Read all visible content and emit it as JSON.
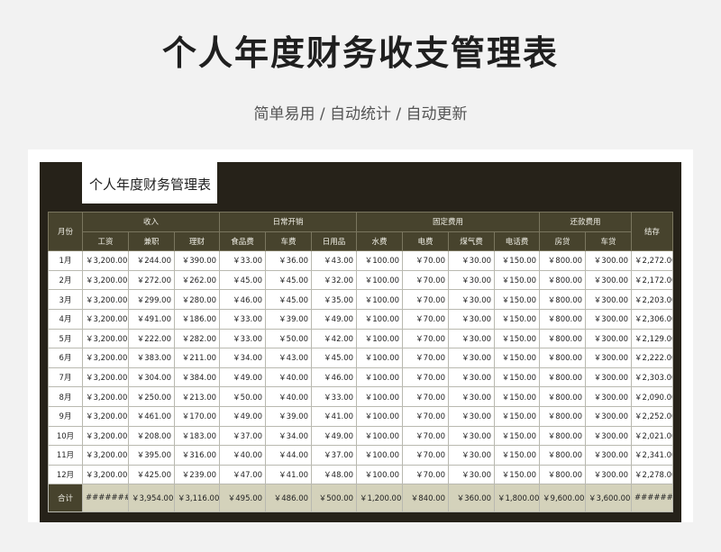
{
  "page": {
    "title": "个人年度财务收支管理表",
    "subtitle": "简单易用 / 自动统计 / 自动更新"
  },
  "sheet": {
    "title": "个人年度财务管理表",
    "headers": {
      "month": "月份",
      "income": "收入",
      "daily": "日常开销",
      "fixed": "固定费用",
      "repay": "还款费用",
      "balance": "结存",
      "sub": [
        "工资",
        "兼职",
        "理财",
        "食品费",
        "车费",
        "日用品",
        "水费",
        "电费",
        "煤气费",
        "电话费",
        "房贷",
        "车贷"
      ]
    },
    "rows": [
      {
        "month": "1月",
        "cells": [
          "￥3,200.00",
          "￥244.00",
          "￥390.00",
          "￥33.00",
          "￥36.00",
          "￥43.00",
          "￥100.00",
          "￥70.00",
          "￥30.00",
          "￥150.00",
          "￥800.00",
          "￥300.00",
          "￥2,272.00"
        ]
      },
      {
        "month": "2月",
        "cells": [
          "￥3,200.00",
          "￥272.00",
          "￥262.00",
          "￥45.00",
          "￥45.00",
          "￥32.00",
          "￥100.00",
          "￥70.00",
          "￥30.00",
          "￥150.00",
          "￥800.00",
          "￥300.00",
          "￥2,172.00"
        ]
      },
      {
        "month": "3月",
        "cells": [
          "￥3,200.00",
          "￥299.00",
          "￥280.00",
          "￥46.00",
          "￥45.00",
          "￥35.00",
          "￥100.00",
          "￥70.00",
          "￥30.00",
          "￥150.00",
          "￥800.00",
          "￥300.00",
          "￥2,203.00"
        ]
      },
      {
        "month": "4月",
        "cells": [
          "￥3,200.00",
          "￥491.00",
          "￥186.00",
          "￥33.00",
          "￥39.00",
          "￥49.00",
          "￥100.00",
          "￥70.00",
          "￥30.00",
          "￥150.00",
          "￥800.00",
          "￥300.00",
          "￥2,306.00"
        ]
      },
      {
        "month": "5月",
        "cells": [
          "￥3,200.00",
          "￥222.00",
          "￥282.00",
          "￥33.00",
          "￥50.00",
          "￥42.00",
          "￥100.00",
          "￥70.00",
          "￥30.00",
          "￥150.00",
          "￥800.00",
          "￥300.00",
          "￥2,129.00"
        ]
      },
      {
        "month": "6月",
        "cells": [
          "￥3,200.00",
          "￥383.00",
          "￥211.00",
          "￥34.00",
          "￥43.00",
          "￥45.00",
          "￥100.00",
          "￥70.00",
          "￥30.00",
          "￥150.00",
          "￥800.00",
          "￥300.00",
          "￥2,222.00"
        ]
      },
      {
        "month": "7月",
        "cells": [
          "￥3,200.00",
          "￥304.00",
          "￥384.00",
          "￥49.00",
          "￥40.00",
          "￥46.00",
          "￥100.00",
          "￥70.00",
          "￥30.00",
          "￥150.00",
          "￥800.00",
          "￥300.00",
          "￥2,303.00"
        ]
      },
      {
        "month": "8月",
        "cells": [
          "￥3,200.00",
          "￥250.00",
          "￥213.00",
          "￥50.00",
          "￥40.00",
          "￥33.00",
          "￥100.00",
          "￥70.00",
          "￥30.00",
          "￥150.00",
          "￥800.00",
          "￥300.00",
          "￥2,090.00"
        ]
      },
      {
        "month": "9月",
        "cells": [
          "￥3,200.00",
          "￥461.00",
          "￥170.00",
          "￥49.00",
          "￥39.00",
          "￥41.00",
          "￥100.00",
          "￥70.00",
          "￥30.00",
          "￥150.00",
          "￥800.00",
          "￥300.00",
          "￥2,252.00"
        ]
      },
      {
        "month": "10月",
        "cells": [
          "￥3,200.00",
          "￥208.00",
          "￥183.00",
          "￥37.00",
          "￥34.00",
          "￥49.00",
          "￥100.00",
          "￥70.00",
          "￥30.00",
          "￥150.00",
          "￥800.00",
          "￥300.00",
          "￥2,021.00"
        ]
      },
      {
        "month": "11月",
        "cells": [
          "￥3,200.00",
          "￥395.00",
          "￥316.00",
          "￥40.00",
          "￥44.00",
          "￥37.00",
          "￥100.00",
          "￥70.00",
          "￥30.00",
          "￥150.00",
          "￥800.00",
          "￥300.00",
          "￥2,341.00"
        ]
      },
      {
        "month": "12月",
        "cells": [
          "￥3,200.00",
          "￥425.00",
          "￥239.00",
          "￥47.00",
          "￥41.00",
          "￥48.00",
          "￥100.00",
          "￥70.00",
          "￥30.00",
          "￥150.00",
          "￥800.00",
          "￥300.00",
          "￥2,278.00"
        ]
      }
    ],
    "total": {
      "label": "合计",
      "cells": [
        "#########",
        "￥3,954.00",
        "￥3,116.00",
        "￥495.00",
        "￥486.00",
        "￥500.00",
        "￥1,200.00",
        "￥840.00",
        "￥360.00",
        "￥1,800.00",
        "￥9,600.00",
        "￥3,600.00",
        "#########"
      ]
    }
  }
}
